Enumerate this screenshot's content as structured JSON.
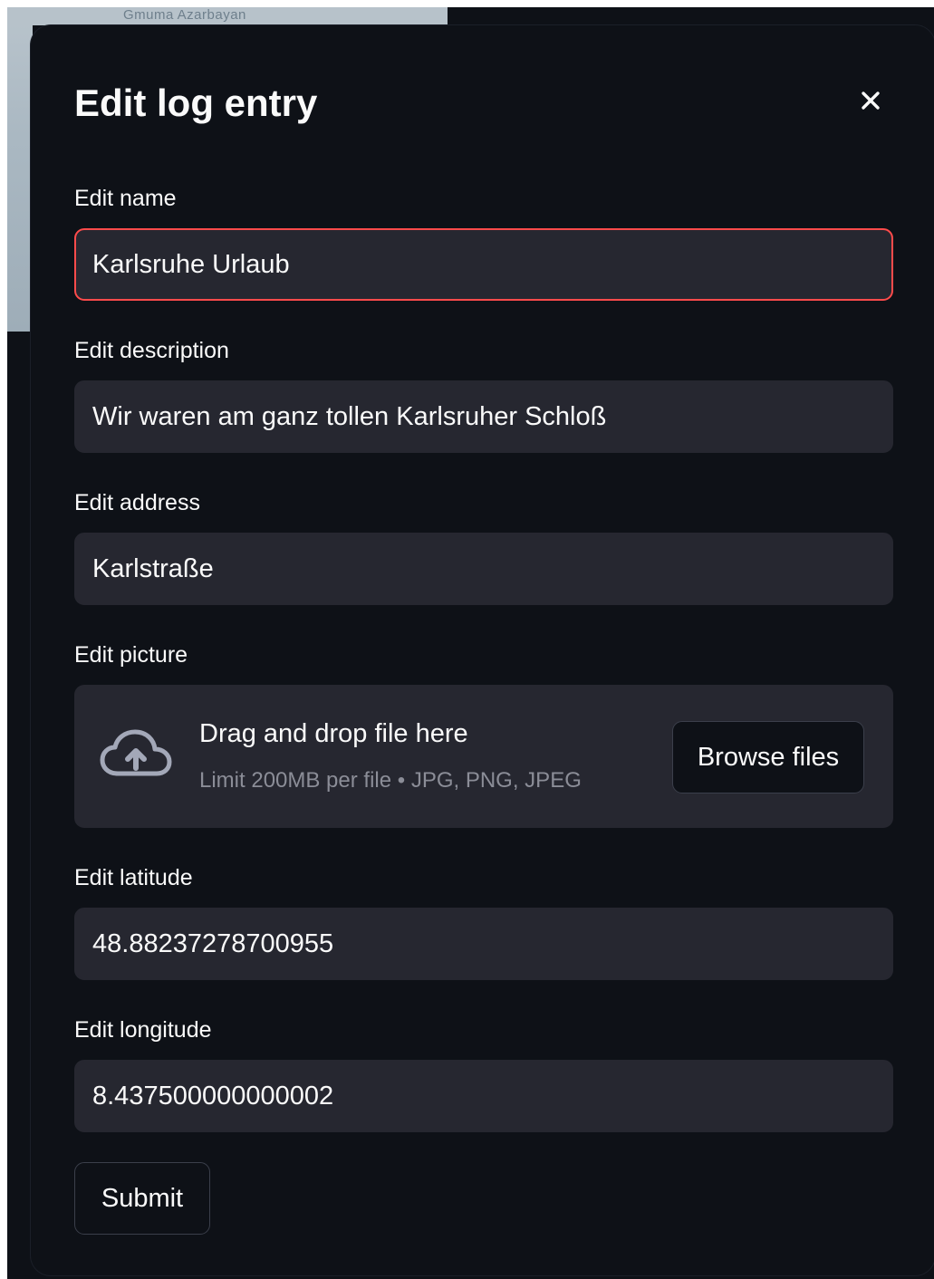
{
  "background": {
    "map_label": "Gmuma Azarbayan"
  },
  "dialog": {
    "title": "Edit log entry",
    "close_icon": "close-icon"
  },
  "fields": {
    "name": {
      "label": "Edit name",
      "value": "Karlsruhe Urlaub"
    },
    "description": {
      "label": "Edit description",
      "value": "Wir waren am ganz tollen Karlsruher Schloß"
    },
    "address": {
      "label": "Edit address",
      "value": "Karlstraße"
    },
    "picture": {
      "label": "Edit picture",
      "dropzone_title": "Drag and drop file here",
      "dropzone_limit": "Limit 200MB per file • JPG, PNG, JPEG",
      "browse_label": "Browse files",
      "icon": "cloud-upload-icon"
    },
    "latitude": {
      "label": "Edit latitude",
      "value": "48.88237278700955"
    },
    "longitude": {
      "label": "Edit longitude",
      "value": "8.437500000000002"
    }
  },
  "actions": {
    "submit_label": "Submit"
  },
  "colors": {
    "background": "#0e1117",
    "input_bg": "#262730",
    "focus_border": "#ff4b4b",
    "text": "#fafafa",
    "muted_text": "#8b8d97"
  }
}
